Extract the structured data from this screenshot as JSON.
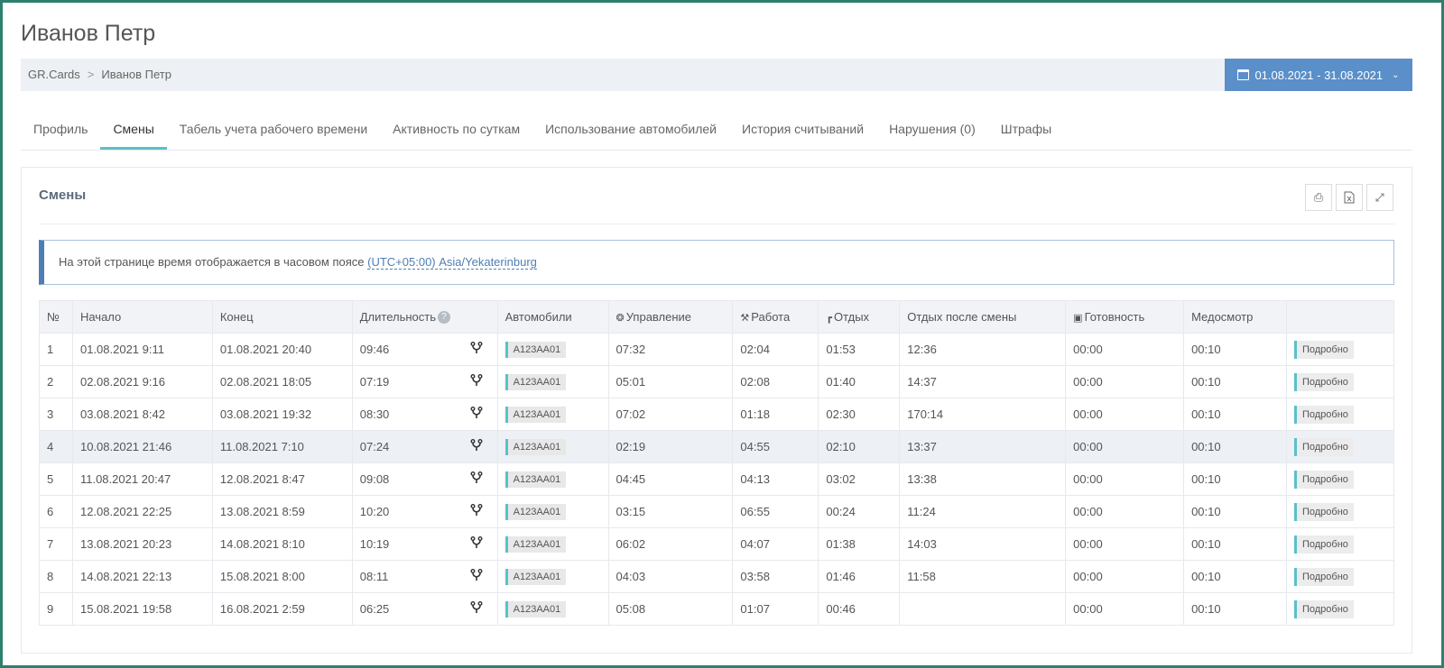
{
  "page": {
    "title": "Иванов Петр"
  },
  "breadcrumb": {
    "root": "GR.Cards",
    "separator": ">",
    "current": "Иванов Петр"
  },
  "date_range": {
    "label": "01.08.2021 - 31.08.2021"
  },
  "tabs": [
    {
      "label": "Профиль",
      "active": false
    },
    {
      "label": "Смены",
      "active": true
    },
    {
      "label": "Табель учета рабочего времени",
      "active": false
    },
    {
      "label": "Активность по суткам",
      "active": false
    },
    {
      "label": "Использование автомобилей",
      "active": false
    },
    {
      "label": "История считываний",
      "active": false
    },
    {
      "label": "Нарушения (0)",
      "active": false
    },
    {
      "label": "Штрафы",
      "active": false
    }
  ],
  "panel": {
    "title": "Смены"
  },
  "alert": {
    "text": "На этой странице время отображается в часовом поясе",
    "timezone": "(UTC+05:00) Asia/Yekaterinburg"
  },
  "table": {
    "headers": {
      "num": "№",
      "start": "Начало",
      "end": "Конец",
      "duration": "Длительность",
      "help": "?",
      "cars": "Автомобили",
      "driving": "Управление",
      "work": "Работа",
      "rest": "Отдых",
      "rest_after": "Отдых после смены",
      "ready": "Готовность",
      "medical": "Медосмотр"
    },
    "rows": [
      {
        "num": "1",
        "start": "01.08.2021 9:11",
        "end": "01.08.2021 20:40",
        "duration": "09:46",
        "car": "A123AA01",
        "driving": "07:32",
        "work": "02:04",
        "rest": "01:53",
        "rest_after": "12:36",
        "ready": "00:00",
        "medical": "00:10",
        "details": "Подробно"
      },
      {
        "num": "2",
        "start": "02.08.2021 9:16",
        "end": "02.08.2021 18:05",
        "duration": "07:19",
        "car": "A123AA01",
        "driving": "05:01",
        "work": "02:08",
        "rest": "01:40",
        "rest_after": "14:37",
        "ready": "00:00",
        "medical": "00:10",
        "details": "Подробно"
      },
      {
        "num": "3",
        "start": "03.08.2021 8:42",
        "end": "03.08.2021 19:32",
        "duration": "08:30",
        "car": "A123AA01",
        "driving": "07:02",
        "work": "01:18",
        "rest": "02:30",
        "rest_after": "170:14",
        "ready": "00:00",
        "medical": "00:10",
        "details": "Подробно"
      },
      {
        "num": "4",
        "start": "10.08.2021 21:46",
        "end": "11.08.2021 7:10",
        "duration": "07:24",
        "car": "A123AA01",
        "driving": "02:19",
        "work": "04:55",
        "rest": "02:10",
        "rest_after": "13:37",
        "ready": "00:00",
        "medical": "00:10",
        "details": "Подробно"
      },
      {
        "num": "5",
        "start": "11.08.2021 20:47",
        "end": "12.08.2021 8:47",
        "duration": "09:08",
        "car": "A123AA01",
        "driving": "04:45",
        "work": "04:13",
        "rest": "03:02",
        "rest_after": "13:38",
        "ready": "00:00",
        "medical": "00:10",
        "details": "Подробно"
      },
      {
        "num": "6",
        "start": "12.08.2021 22:25",
        "end": "13.08.2021 8:59",
        "duration": "10:20",
        "car": "A123AA01",
        "driving": "03:15",
        "work": "06:55",
        "rest": "00:24",
        "rest_after": "11:24",
        "ready": "00:00",
        "medical": "00:10",
        "details": "Подробно"
      },
      {
        "num": "7",
        "start": "13.08.2021 20:23",
        "end": "14.08.2021 8:10",
        "duration": "10:19",
        "car": "A123AA01",
        "driving": "06:02",
        "work": "04:07",
        "rest": "01:38",
        "rest_after": "14:03",
        "ready": "00:00",
        "medical": "00:10",
        "details": "Подробно"
      },
      {
        "num": "8",
        "start": "14.08.2021 22:13",
        "end": "15.08.2021 8:00",
        "duration": "08:11",
        "car": "A123AA01",
        "driving": "04:03",
        "work": "03:58",
        "rest": "01:46",
        "rest_after": "11:58",
        "ready": "00:00",
        "medical": "00:10",
        "details": "Подробно"
      },
      {
        "num": "9",
        "start": "15.08.2021 19:58",
        "end": "16.08.2021 2:59",
        "duration": "06:25",
        "car": "A123AA01",
        "driving": "05:08",
        "work": "01:07",
        "rest": "00:46",
        "rest_after": "",
        "ready": "00:00",
        "medical": "00:10",
        "details": "Подробно"
      }
    ],
    "highlighted_row": 4
  },
  "icons": {
    "calendar": "calendar-icon",
    "chevron": "chevron-down-icon",
    "print": "print-icon",
    "excel": "excel-icon",
    "expand": "expand-icon",
    "route": "route-icon"
  },
  "colors": {
    "accent": "#5bc0c8",
    "date_button": "#5a8fc9",
    "alert_border": "#4e7fb4",
    "frame": "#2f7f6f"
  }
}
